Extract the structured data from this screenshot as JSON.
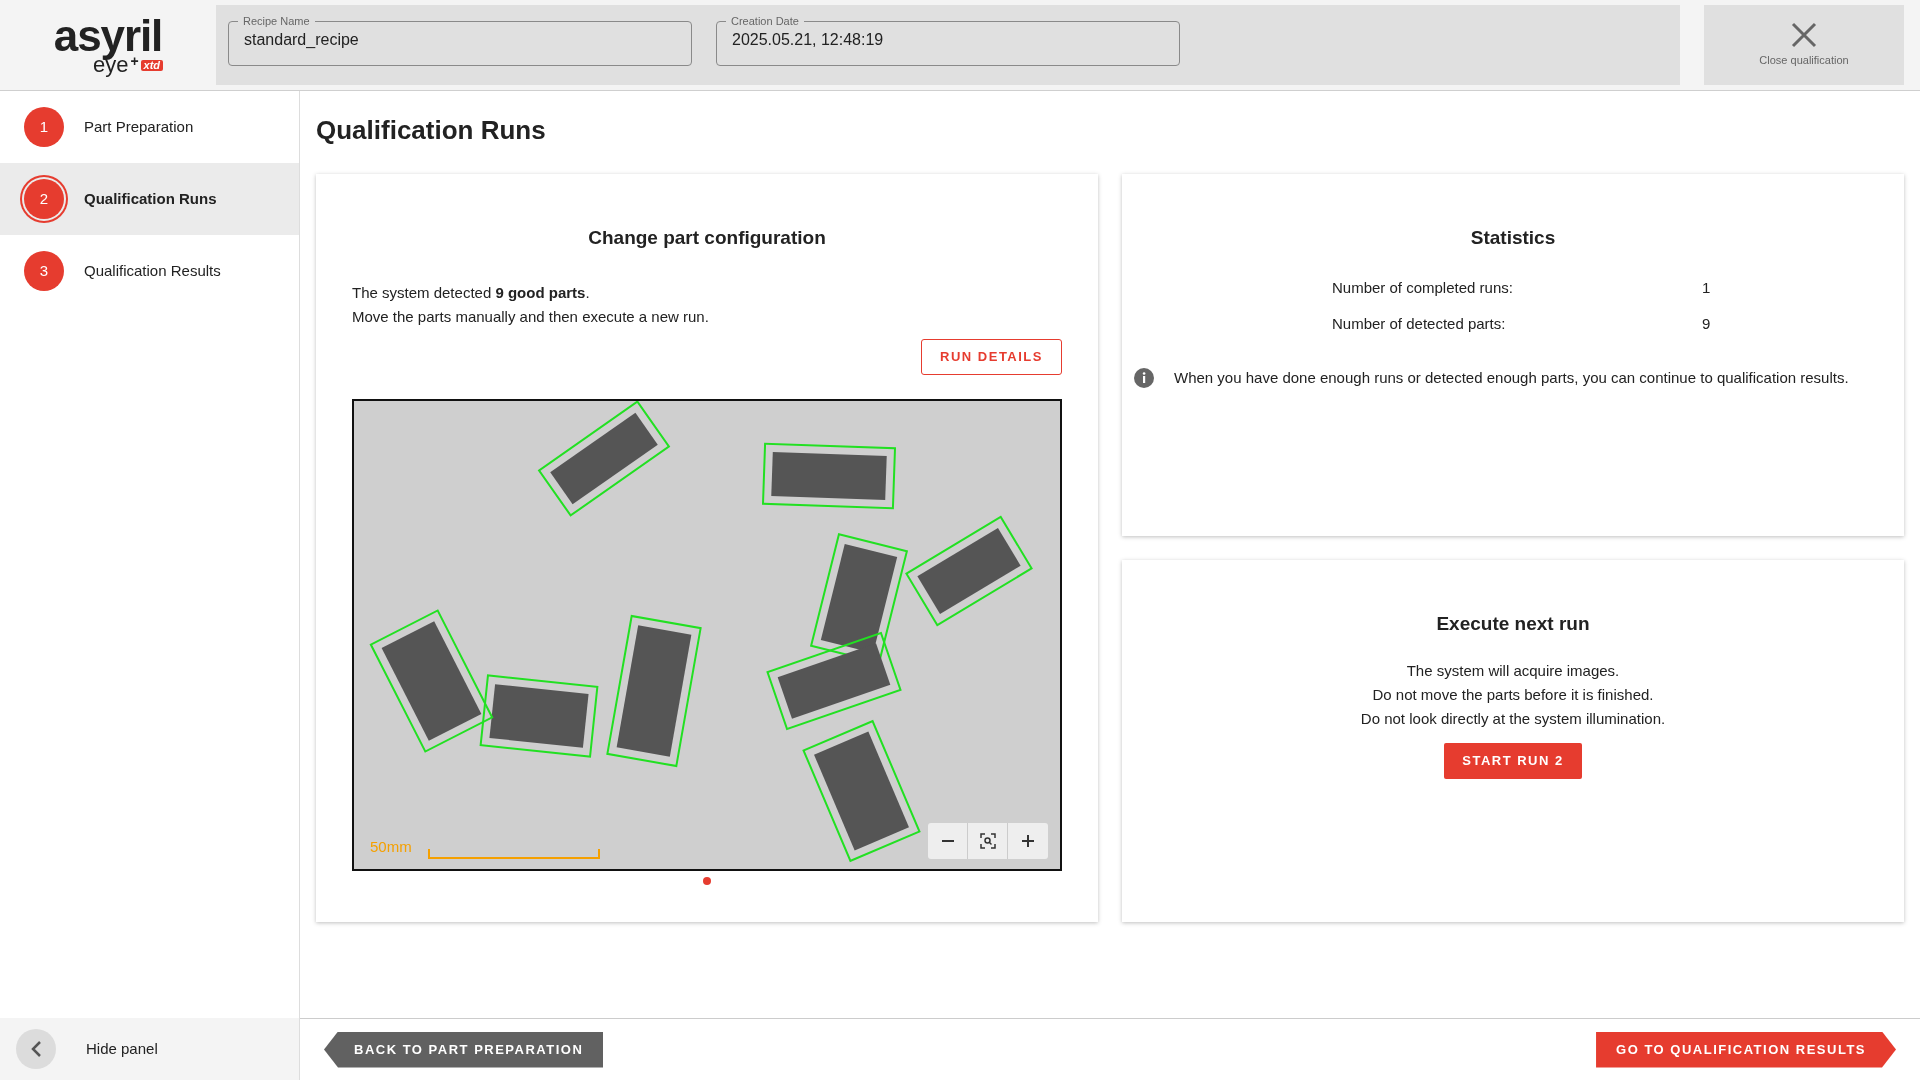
{
  "logo": {
    "brand": "asyril",
    "product": "eye",
    "plus": "+",
    "edition": "xtd"
  },
  "header": {
    "fields": [
      {
        "label": "Recipe Name",
        "value": "standard_recipe"
      },
      {
        "label": "Creation Date",
        "value": "2025.05.21, 12:48:19"
      }
    ],
    "close_button": {
      "label": "Close qualification"
    }
  },
  "sidebar": {
    "steps": [
      {
        "number": "1",
        "label": "Part Preparation",
        "selected": false
      },
      {
        "number": "2",
        "label": "Qualification Runs",
        "selected": true
      },
      {
        "number": "3",
        "label": "Qualification Results",
        "selected": false
      }
    ],
    "hide_panel": "Hide panel"
  },
  "page_title": "Qualification Runs",
  "configuration_card": {
    "title": "Change part configuration",
    "lines": [
      "The system detected **9 good parts**.",
      "Move the parts manually and then execute a new run."
    ],
    "button": "RUN DETAILS",
    "scale_label": "50mm",
    "pages": [
      {
        "selected": true
      }
    ]
  },
  "statistics_card": {
    "title": "Statistics",
    "rows": [
      {
        "label": "Number of completed runs:",
        "value": "1"
      },
      {
        "label": "Number of detected parts:",
        "value": "9"
      }
    ],
    "info": "When you have done enough runs or detected enough parts, you can continue to qualification results."
  },
  "next_run_card": {
    "title": "Execute next run",
    "lines": [
      "The system will acquire images.",
      "Do not move the parts before it is finished.",
      "Do not look directly at the system illumination."
    ],
    "button": "START RUN 2"
  },
  "footer": {
    "back_button": "BACK TO PART PREPARATION",
    "next_button": "GO TO QUALIFICATION RESULTS"
  }
}
